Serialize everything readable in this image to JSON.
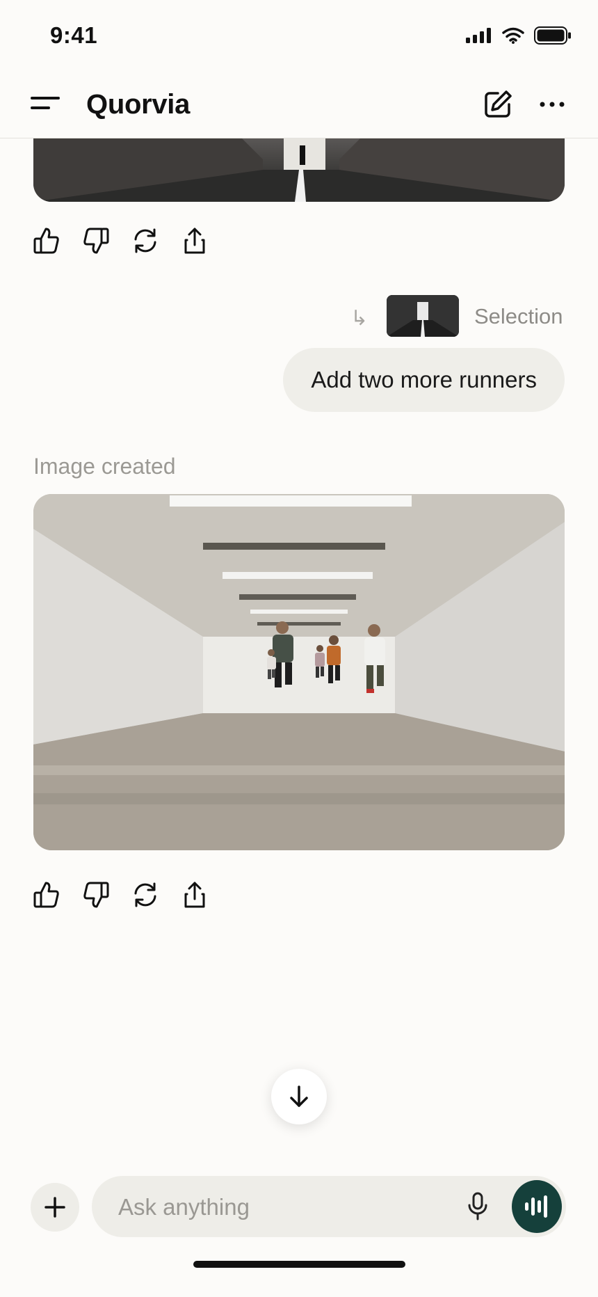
{
  "status_bar": {
    "time": "9:41",
    "icons": [
      "signal-icon",
      "wifi-icon",
      "battery-icon"
    ]
  },
  "header": {
    "title": "Quorvia",
    "icons": [
      "menu-icon",
      "new-chat-icon",
      "more-icon"
    ]
  },
  "conversation": {
    "message_actions": [
      "thumbs-up-icon",
      "thumbs-down-icon",
      "regenerate-icon",
      "share-icon"
    ],
    "selection": {
      "reply_glyph": "↳",
      "label": "Selection"
    },
    "user_message": "Add two more runners",
    "assistant": {
      "status_label": "Image created"
    }
  },
  "composer": {
    "placeholder": "Ask anything",
    "icons": [
      "plus-icon",
      "microphone-icon",
      "voice-mode-icon",
      "arrow-down-icon"
    ]
  },
  "colors": {
    "background": "#fcfbf9",
    "bubble": "#efeee9",
    "accent": "#15403b",
    "muted_text": "#9b9994"
  }
}
